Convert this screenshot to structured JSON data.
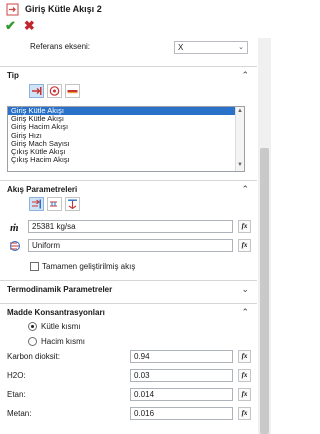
{
  "title": "Giriş Kütle Akışı 2",
  "actions": {
    "ok": "✔",
    "cancel": "✖"
  },
  "reference_axis": {
    "label": "Referans ekseni:",
    "value": "X"
  },
  "tip": {
    "header": "Tip",
    "options": [
      "Giriş Kütle Akışı",
      "Giriş Kütle Akışı",
      "Giriş Hacim Akışı",
      "Giriş Hızı",
      "Giriş Mach Sayısı",
      "Çıkış Kütle Akışı",
      "Çıkış Hacim Akışı"
    ],
    "selected_index": 0
  },
  "flow_params": {
    "header": "Akış Parametreleri",
    "mass_flow_symbol": "ṁ",
    "mass_flow_value": "25381 kg/sa",
    "profile_value": "Uniform",
    "fully_developed_label": "Tamamen geliştirilmiş akış",
    "fully_developed_checked": false
  },
  "thermo": {
    "header": "Termodinamik Parametreler"
  },
  "concentrations": {
    "header": "Madde Konsantrasyonları",
    "mode_options": [
      "Kütle kısmı",
      "Hacim kısmı"
    ],
    "mode_selected": 0,
    "rows": [
      {
        "label": "Karbon dioksit:",
        "value": "0.94"
      },
      {
        "label": "H2O:",
        "value": "0.03"
      },
      {
        "label": "Etan:",
        "value": "0.014"
      },
      {
        "label": "Metan:",
        "value": "0.016"
      }
    ]
  },
  "fx_label": "fx",
  "colors": {
    "accent": "#2a72c9",
    "ok": "#2e9b2e",
    "cancel": "#c0262c"
  }
}
